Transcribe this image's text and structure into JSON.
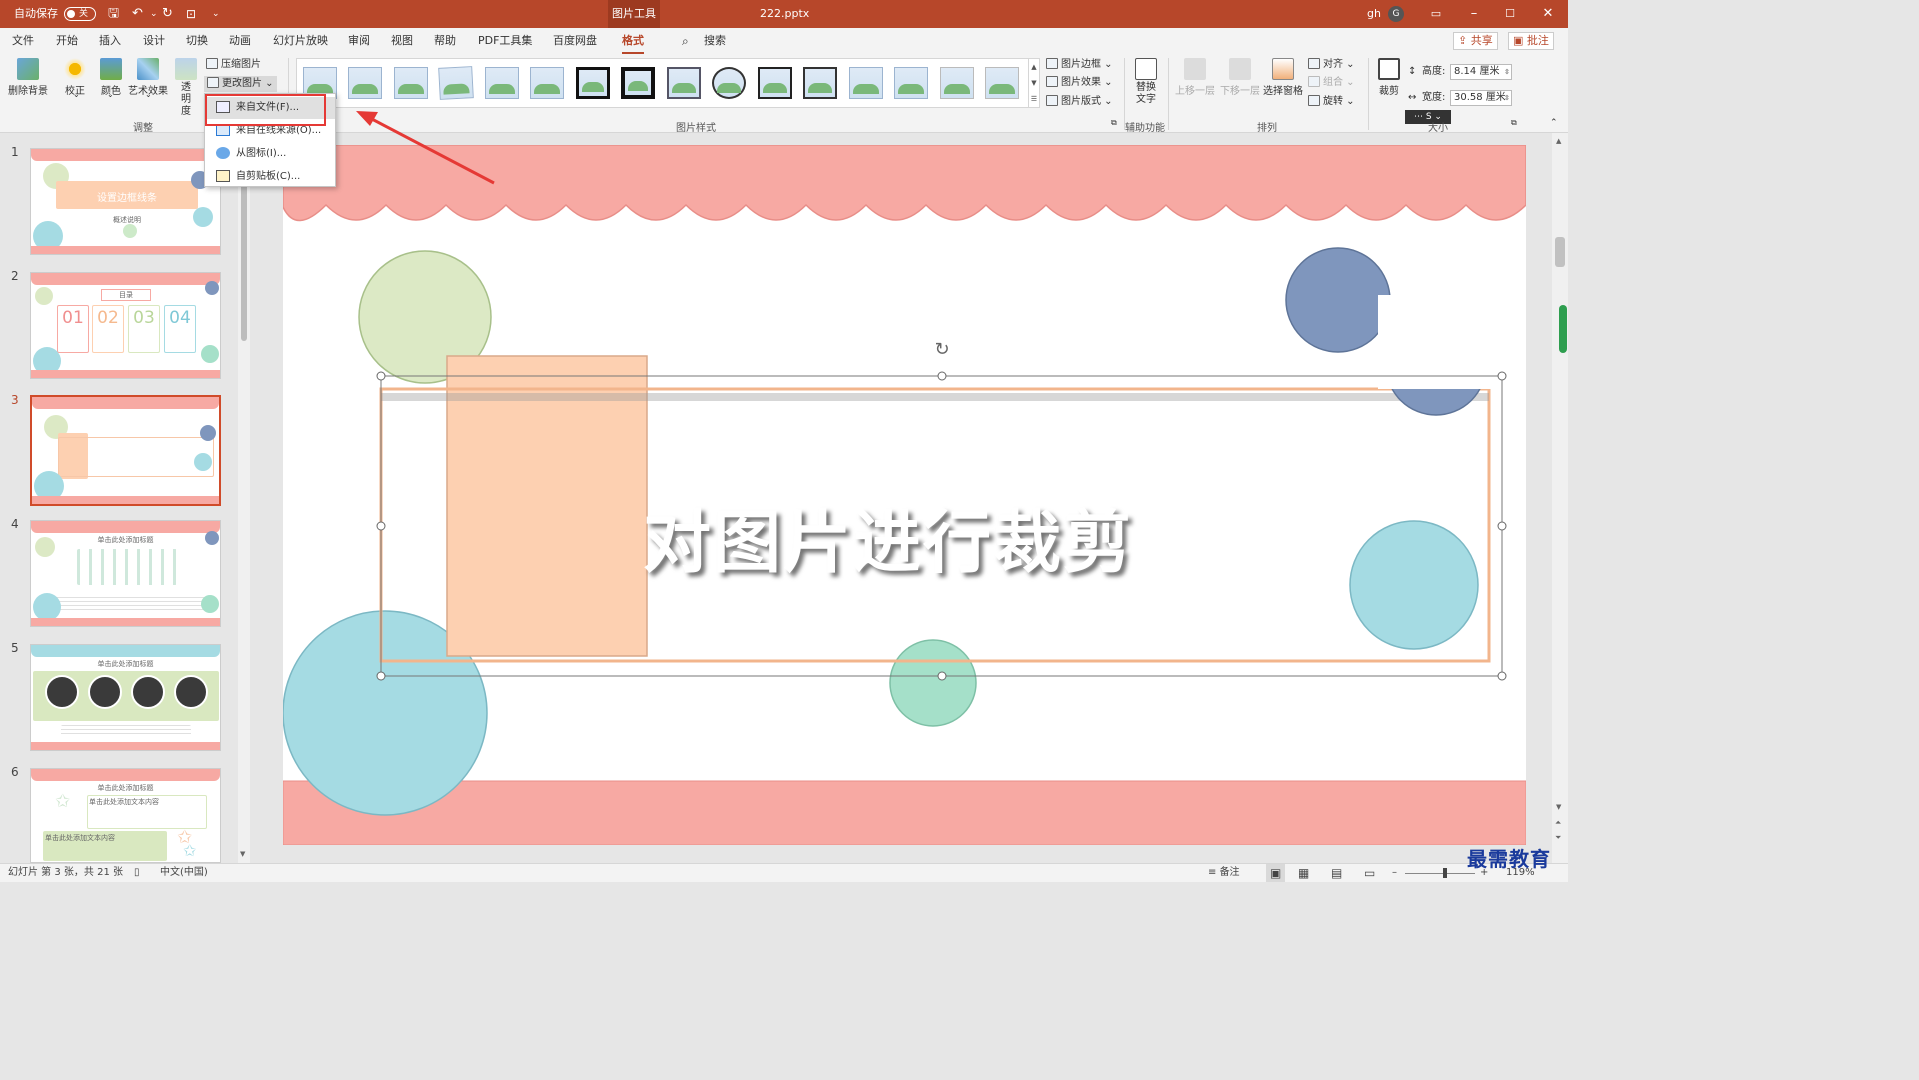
{
  "titlebar": {
    "autosave_label": "自动保存",
    "autosave_state": "关",
    "context_tab": "图片工具",
    "filename": "222.pptx",
    "user_name": "gh",
    "user_initial": "G"
  },
  "menu": {
    "items": [
      "文件",
      "开始",
      "插入",
      "设计",
      "切换",
      "动画",
      "幻灯片放映",
      "审阅",
      "视图",
      "帮助",
      "PDF工具集",
      "百度网盘",
      "格式"
    ],
    "active": "格式",
    "search": "搜索",
    "share": "共享",
    "comments": "批注"
  },
  "ribbon": {
    "adjust": {
      "remove_bg": "删除背景",
      "correct": "校正",
      "color": "颜色",
      "art": "艺术效果",
      "transparency": "透明度",
      "compress": "压缩图片",
      "change": "更改图片",
      "group_label": "调整"
    },
    "styles_group_label": "图片样式",
    "picture_border": "图片边框",
    "picture_effects": "图片效果",
    "picture_layout": "图片版式",
    "alt_text": "替换文字",
    "accessibility_label": "辅助功能",
    "arrange": {
      "forward": "上移一层",
      "backward": "下移一层",
      "selection_pane": "选择窗格",
      "align": "对齐",
      "group": "组合",
      "rotate": "旋转",
      "group_label": "排列"
    },
    "size": {
      "crop": "裁剪",
      "height_label": "高度:",
      "height_value": "8.14 厘米",
      "width_label": "宽度:",
      "width_value": "30.58 厘米",
      "group_label": "大小"
    }
  },
  "dropdown": {
    "items": [
      "来自文件(F)...",
      "来自在线来源(O)...",
      "从图标(I)...",
      "自剪贴板(C)..."
    ]
  },
  "slides": [
    {
      "num": "1",
      "title": "设置边框线条",
      "sub": "概述说明"
    },
    {
      "num": "2",
      "title": "目录",
      "items": [
        "01",
        "02",
        "03",
        "04"
      ]
    },
    {
      "num": "3"
    },
    {
      "num": "4",
      "title": "单击此处添加标题"
    },
    {
      "num": "5",
      "title": "单击此处添加标题"
    },
    {
      "num": "6",
      "title": "单击此处添加标题",
      "sub": "单击此处添加文本内容",
      "sub2": "单击此处添加文本内容"
    }
  ],
  "main_slide": {
    "title": "对图片进行裁剪"
  },
  "statusbar": {
    "slide_info": "幻灯片 第 3 张，共 21 张",
    "language": "中文(中国)",
    "notes": "备注",
    "zoom": "119%"
  },
  "watermark": "最需教育",
  "colors": {
    "accent": "#b7472a",
    "pink": "#f7a9a3",
    "peach": "#fdd0b1",
    "blue": "#7f96bd",
    "teal": "#a5dbe3",
    "green": "#d9e8c0",
    "callout": "#e53935"
  }
}
